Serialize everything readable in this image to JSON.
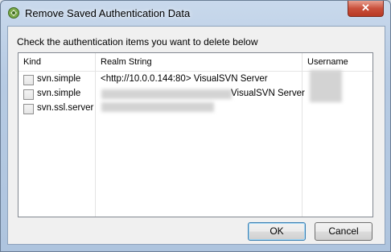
{
  "window": {
    "title": "Remove Saved Authentication Data",
    "close_label": "✕"
  },
  "dialog": {
    "instruction": "Check the authentication items you want to delete below"
  },
  "list": {
    "columns": [
      "Kind",
      "Realm String",
      "Username"
    ],
    "rows": [
      {
        "kind": "svn.simple",
        "realm": "<http://10.0.0.144:80> VisualSVN Server",
        "checked": false
      },
      {
        "kind": "svn.simple",
        "realm": "VisualSVN Server",
        "checked": false
      },
      {
        "kind": "svn.ssl.server",
        "realm": "",
        "checked": false
      }
    ]
  },
  "buttons": {
    "ok_label": "OK",
    "cancel_label": "Cancel"
  }
}
